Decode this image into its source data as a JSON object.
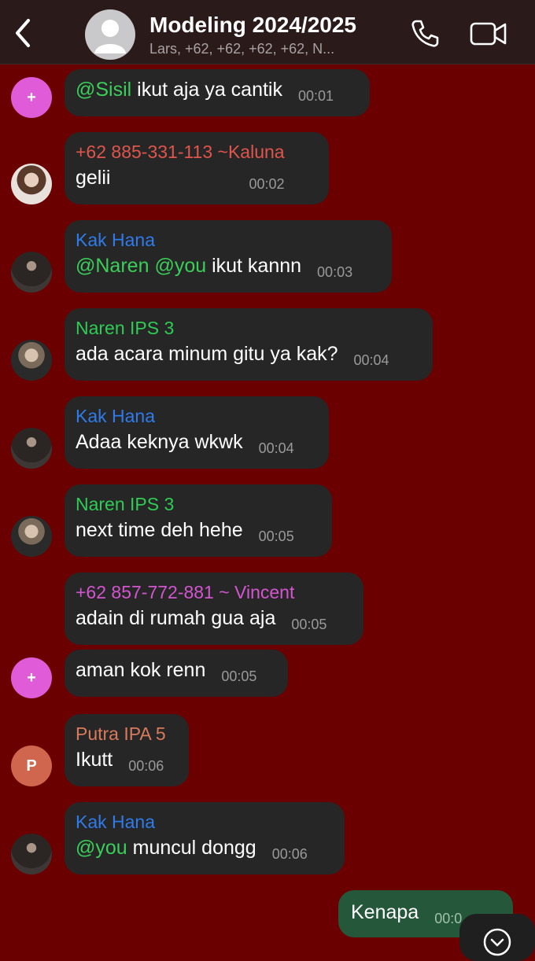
{
  "header": {
    "title": "Modeling 2024/2025",
    "subtitle": "Lars, +62, +62, +62, +62, N..."
  },
  "colors": {
    "background": "#6b0000",
    "bubble_incoming": "#262626",
    "bubble_outgoing": "#25573a",
    "mention": "#3bcf5a"
  },
  "messages": [
    {
      "sender": "",
      "parts": [
        {
          "t": "@Sisil",
          "mention": true
        },
        {
          "t": " ikut aja ya cantik"
        }
      ],
      "time": "00:01",
      "avatar": "+"
    },
    {
      "sender": "+62 885-331-113 ~Kaluna",
      "parts": [
        {
          "t": "gelii"
        }
      ],
      "time": "00:02",
      "avatar": "photo-girl"
    },
    {
      "sender": "Kak Hana",
      "parts": [
        {
          "t": "@Naren",
          "mention": true
        },
        {
          "t": " "
        },
        {
          "t": "@you",
          "mention": true
        },
        {
          "t": " ikut kannn"
        }
      ],
      "time": "00:03",
      "avatar": "photo-dark"
    },
    {
      "sender": "Naren IPS 3",
      "parts": [
        {
          "t": "ada acara minum gitu ya kak?"
        }
      ],
      "time": "00:04",
      "avatar": "photo-boy"
    },
    {
      "sender": "Kak Hana",
      "parts": [
        {
          "t": "Adaa keknya wkwk"
        }
      ],
      "time": "00:04",
      "avatar": "photo-dark"
    },
    {
      "sender": "Naren IPS 3",
      "parts": [
        {
          "t": "next time deh hehe"
        }
      ],
      "time": "00:05",
      "avatar": "photo-boy"
    },
    {
      "sender": "+62 857-772-881 ~ Vincent",
      "parts": [
        {
          "t": "adain di rumah gua aja"
        }
      ],
      "time": "00:05",
      "avatar": ""
    },
    {
      "sender": "",
      "parts": [
        {
          "t": "aman kok renn"
        }
      ],
      "time": "00:05",
      "avatar": "+"
    },
    {
      "sender": "Putra IPA 5",
      "parts": [
        {
          "t": "Ikutt"
        }
      ],
      "time": "00:06",
      "avatar": "P"
    },
    {
      "sender": "Kak Hana",
      "parts": [
        {
          "t": "@you",
          "mention": true
        },
        {
          "t": " muncul dongg"
        }
      ],
      "time": "00:06",
      "avatar": "photo-dark"
    }
  ],
  "own_message": {
    "text": "Kenapa",
    "time": "00:0"
  },
  "icons": [
    "chevron-left-icon",
    "group-avatar-icon",
    "phone-icon",
    "video-camera-icon",
    "chevron-down-icon"
  ]
}
